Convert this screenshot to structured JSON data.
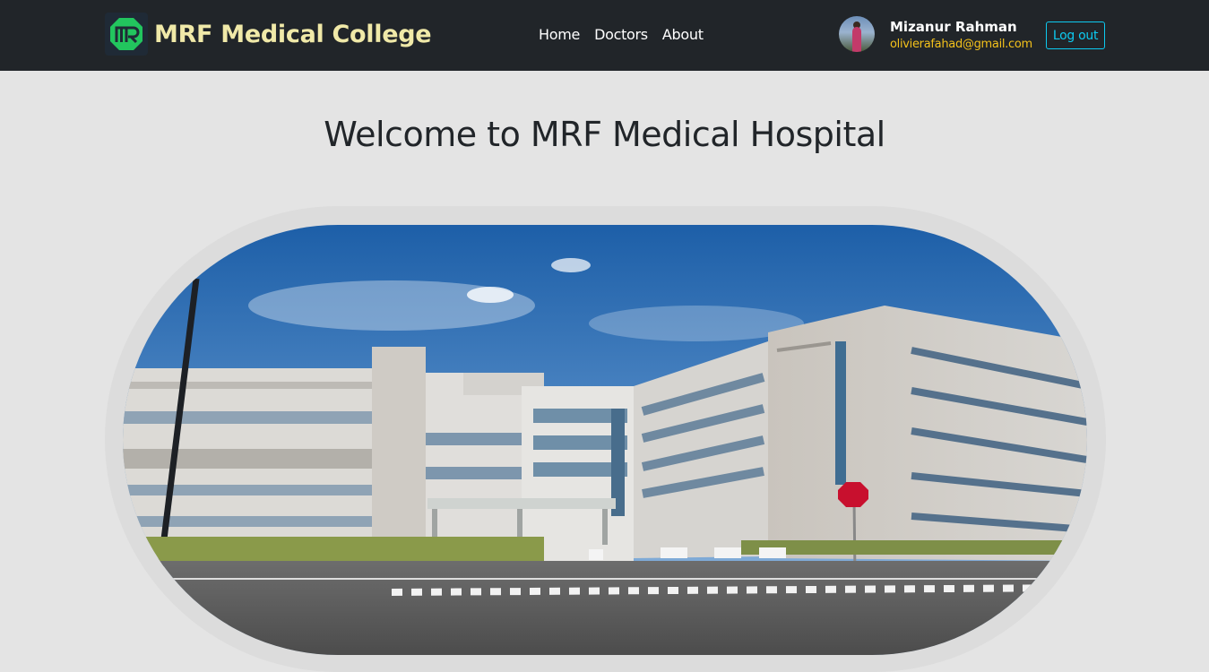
{
  "navbar": {
    "logo_icon": "mr-monogram-logo-icon",
    "brand_name": "MRF Medical College",
    "links": [
      {
        "label": "Home"
      },
      {
        "label": "Doctors"
      },
      {
        "label": "About"
      }
    ],
    "user": {
      "name": "Mizanur Rahman",
      "email": "olivierafahad@gmail.com",
      "avatar": "user-avatar"
    },
    "logout_label": "Log out"
  },
  "hero": {
    "title": "Welcome to MRF Medical Hospital",
    "image": "hospital-building-photo"
  },
  "colors": {
    "navbar_bg": "#212529",
    "brand_text": "#f0e9a8",
    "email_text": "#f3c11b",
    "logout_accent": "#0dcaf0",
    "page_bg": "#e4e4e4"
  }
}
